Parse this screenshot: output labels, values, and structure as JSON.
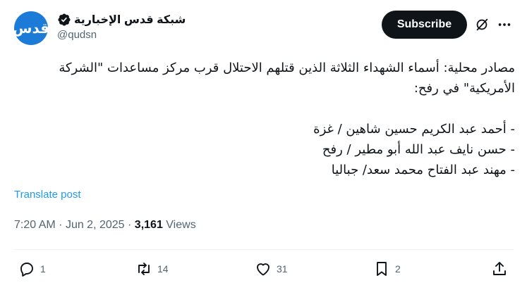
{
  "account": {
    "avatar_text": "قدس",
    "display_name": "شبكة قدس الإخبارية",
    "handle": "@qudsn"
  },
  "header": {
    "subscribe_label": "Subscribe"
  },
  "icons": {
    "verified": "verified-badge-icon",
    "grok": "grok-icon",
    "more": "more-icon"
  },
  "post": {
    "text": "مصادر محلية: أسماء الشهداء الثلاثة الذين قتلهم الاحتلال قرب مركز مساعدات \"الشركة الأمريكية\" في رفح:\n\n- أحمد عبد الكريم حسين شاهين / غزة\n- حسن نايف عبد الله أبو مطير / رفح\n- مهند عبد الفتاح محمد سعد/ جباليا",
    "translate_label": "Translate post",
    "time": "7:20 AM",
    "date": "Jun 2, 2025",
    "views_count": "3,161",
    "views_label": "Views"
  },
  "actions": {
    "replies": "1",
    "reposts": "14",
    "likes": "31",
    "bookmarks": "2"
  },
  "colors": {
    "accent": "#1d9bf0",
    "muted": "#536471",
    "text": "#0f1419"
  }
}
